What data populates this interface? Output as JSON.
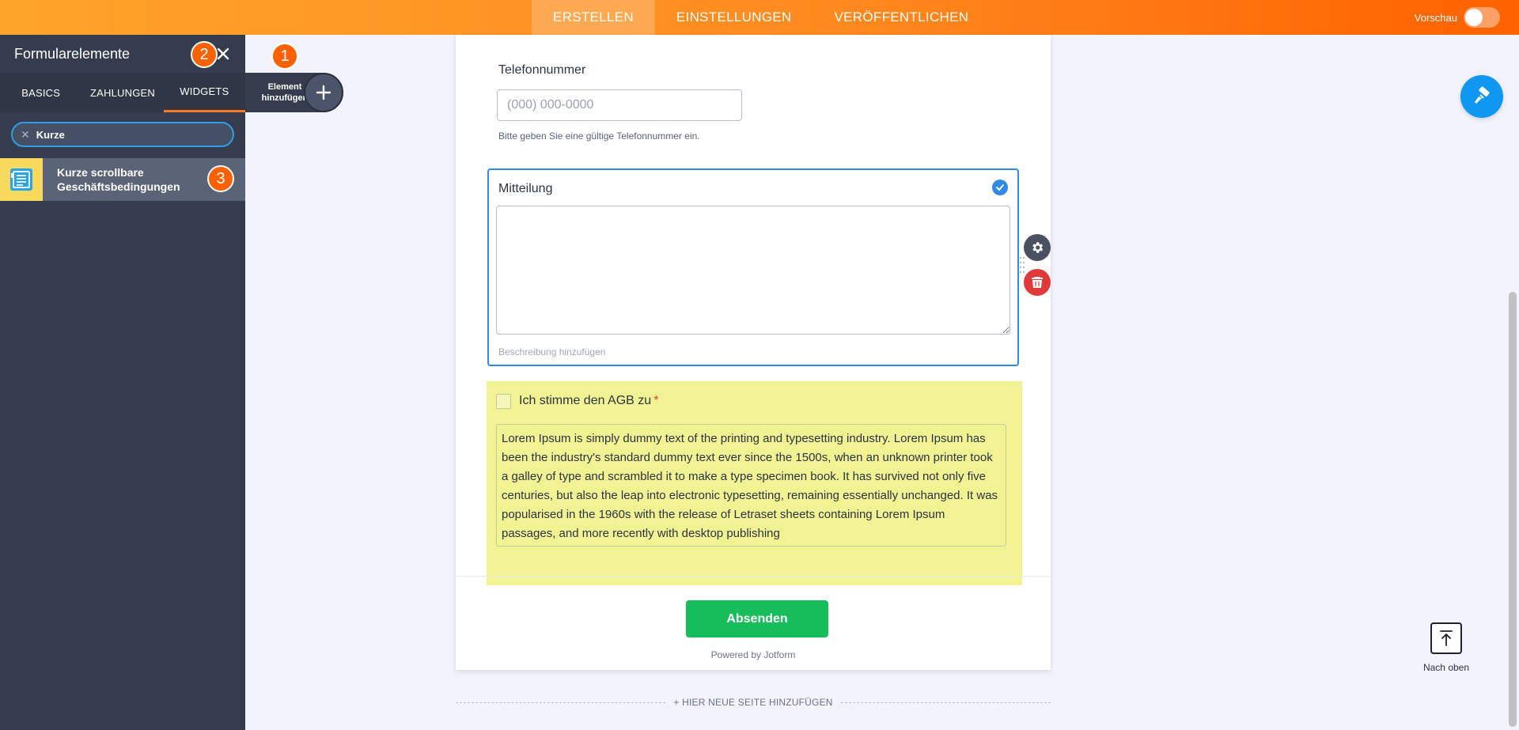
{
  "topbar": {
    "tabs": [
      {
        "label": "ERSTELLEN",
        "active": true
      },
      {
        "label": "EINSTELLUNGEN",
        "active": false
      },
      {
        "label": "VERÖFFENTLICHEN",
        "active": false
      }
    ],
    "preview_label": "Vorschau",
    "preview_on": false
  },
  "sidebar": {
    "title": "Formularelemente",
    "tabs": [
      {
        "label": "BASICS",
        "active": false
      },
      {
        "label": "ZAHLUNGEN",
        "active": false
      },
      {
        "label": "WIDGETS",
        "active": true
      }
    ],
    "search_value": "Kurze",
    "result_label": "Kurze scrollbare Geschäftsbedingungen"
  },
  "badges": [
    "1",
    "2",
    "3"
  ],
  "add_element": {
    "label": "Element hinzufügen"
  },
  "form": {
    "phone": {
      "label": "Telefonnummer",
      "placeholder": "(000) 000-0000",
      "help": "Bitte geben Sie eine gültige Telefonnummer ein."
    },
    "message": {
      "label": "Mitteilung",
      "description_placeholder": "Beschreibung hinzufügen"
    },
    "agb": {
      "label": "Ich stimme den AGB zu",
      "required_mark": "*",
      "text": "Lorem Ipsum is simply dummy text of the printing and typesetting industry. Lorem Ipsum has been the industry's standard dummy text ever since the 1500s, when an unknown printer took a galley of type and scrambled it to make a type specimen book. It has survived not only five centuries, but also the leap into electronic typesetting, remaining essentially unchanged. It was popularised in the 1960s with the release of Letraset sheets containing Lorem Ipsum passages, and more recently with desktop publishing"
    },
    "submit_label": "Absenden",
    "powered_by": "Powered by Jotform"
  },
  "new_page_label": "+ HIER NEUE SEITE HINZUFÜGEN",
  "scroll_top_label": "Nach oben",
  "colors": {
    "accent_orange": "#ff6100",
    "selection_blue": "#2e8ae6",
    "submit_green": "#18bd5b",
    "agb_highlight": "#f1f291",
    "delete_red": "#e03b3b"
  },
  "icons": [
    "close-icon",
    "search-clear-icon",
    "scrollable-terms-icon",
    "plus-icon",
    "check-icon",
    "gear-icon",
    "trash-icon",
    "paint-roller-icon",
    "arrow-up-icon",
    "drag-handle-icon"
  ]
}
